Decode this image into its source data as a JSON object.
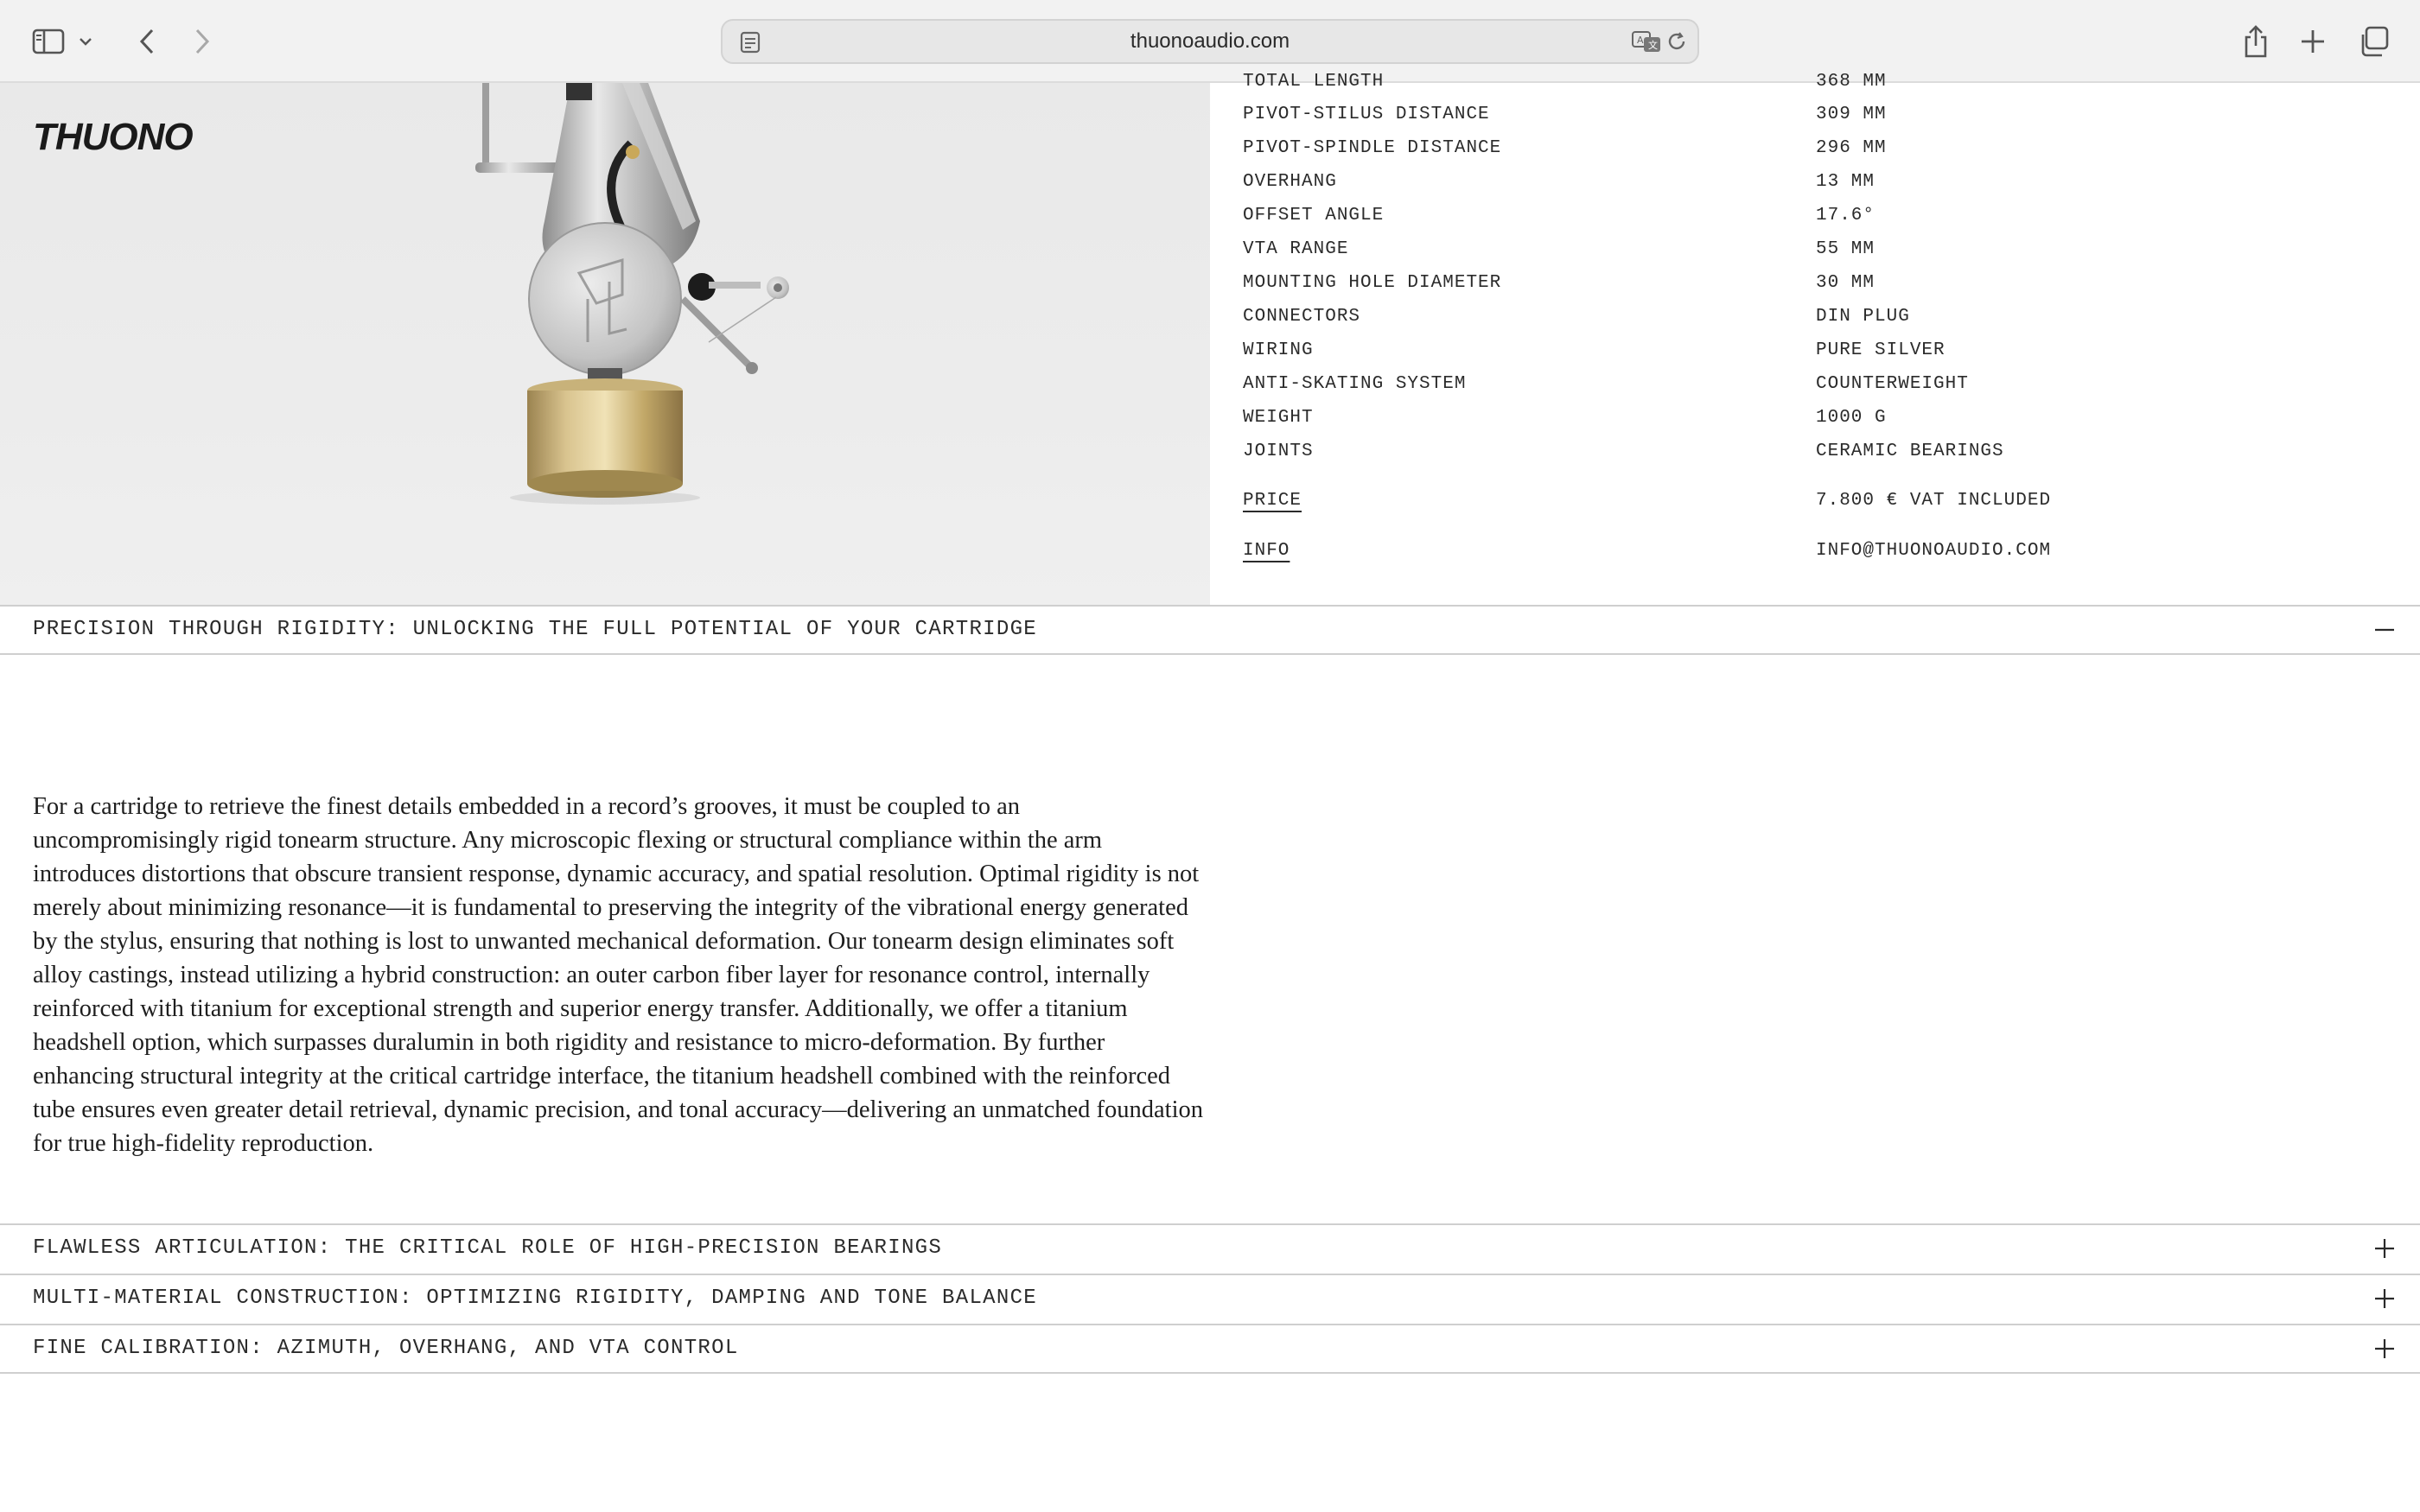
{
  "browser": {
    "url": "thuonoaudio.com",
    "icons": [
      "sidebar-icon",
      "chevron-down-icon",
      "back-icon",
      "forward-icon",
      "site-settings-icon",
      "translate-icon",
      "reload-icon",
      "share-icon",
      "new-tab-icon",
      "tab-overview-icon"
    ]
  },
  "brand": {
    "logo": "THUONO"
  },
  "specs": [
    {
      "label": "TOTAL LENGTH",
      "value": "368 MM"
    },
    {
      "label": "PIVOT-STILUS DISTANCE",
      "value": "309 MM"
    },
    {
      "label": "PIVOT-SPINDLE DISTANCE",
      "value": "296 MM"
    },
    {
      "label": "OVERHANG",
      "value": "13 MM"
    },
    {
      "label": "OFFSET ANGLE",
      "value": "17.6°"
    },
    {
      "label": "VTA RANGE",
      "value": "55 MM"
    },
    {
      "label": "MOUNTING HOLE DIAMETER",
      "value": "30 MM"
    },
    {
      "label": "CONNECTORS",
      "value": "DIN PLUG"
    },
    {
      "label": "WIRING",
      "value": "PURE SILVER"
    },
    {
      "label": "ANTI-SKATING SYSTEM",
      "value": "COUNTERWEIGHT"
    },
    {
      "label": "WEIGHT",
      "value": "1000 G"
    },
    {
      "label": "JOINTS",
      "value": "CERAMIC BEARINGS"
    }
  ],
  "price": {
    "label": "PRICE",
    "value": "7.800 € VAT INCLUDED"
  },
  "info": {
    "label": "INFO",
    "value": "INFO@THUONOAUDIO.COM"
  },
  "accordion": [
    {
      "title": "PRECISION THROUGH RIGIDITY: UNLOCKING THE FULL POTENTIAL OF YOUR CARTRIDGE",
      "expanded": true
    },
    {
      "title": "FLAWLESS ARTICULATION: THE CRITICAL ROLE OF HIGH-PRECISION BEARINGS",
      "expanded": false
    },
    {
      "title": "MULTI-MATERIAL CONSTRUCTION: OPTIMIZING RIGIDITY, DAMPING AND TONE BALANCE",
      "expanded": false
    },
    {
      "title": "FINE CALIBRATION: AZIMUTH, OVERHANG, AND VTA CONTROL",
      "expanded": false
    }
  ],
  "body_text": "For a cartridge to retrieve the finest details embedded in a record’s grooves, it must be coupled to an uncompromisingly rigid tonearm structure. Any microscopic flexing or structural compliance within the arm introduces distortions that obscure transient response, dynamic accuracy, and spatial resolution. Optimal rigidity is not merely about minimizing resonance—it is fundamental to preserving the integrity of the vibrational energy generated by the stylus, ensuring that nothing is lost to unwanted mechanical deformation. Our tonearm design eliminates soft alloy castings, instead utilizing a hybrid construction: an outer carbon fiber layer for resonance control, internally reinforced with titanium for exceptional strength and superior energy transfer. Additionally, we offer a titanium headshell option, which surpasses duralumin in both rigidity and resistance to micro-deformation. By further enhancing structural integrity at the critical cartridge interface, the titanium headshell combined with the reinforced tube ensures even greater detail retrieval, dynamic precision, and tonal accuracy—delivering an unmatched foundation for true high-fidelity reproduction."
}
